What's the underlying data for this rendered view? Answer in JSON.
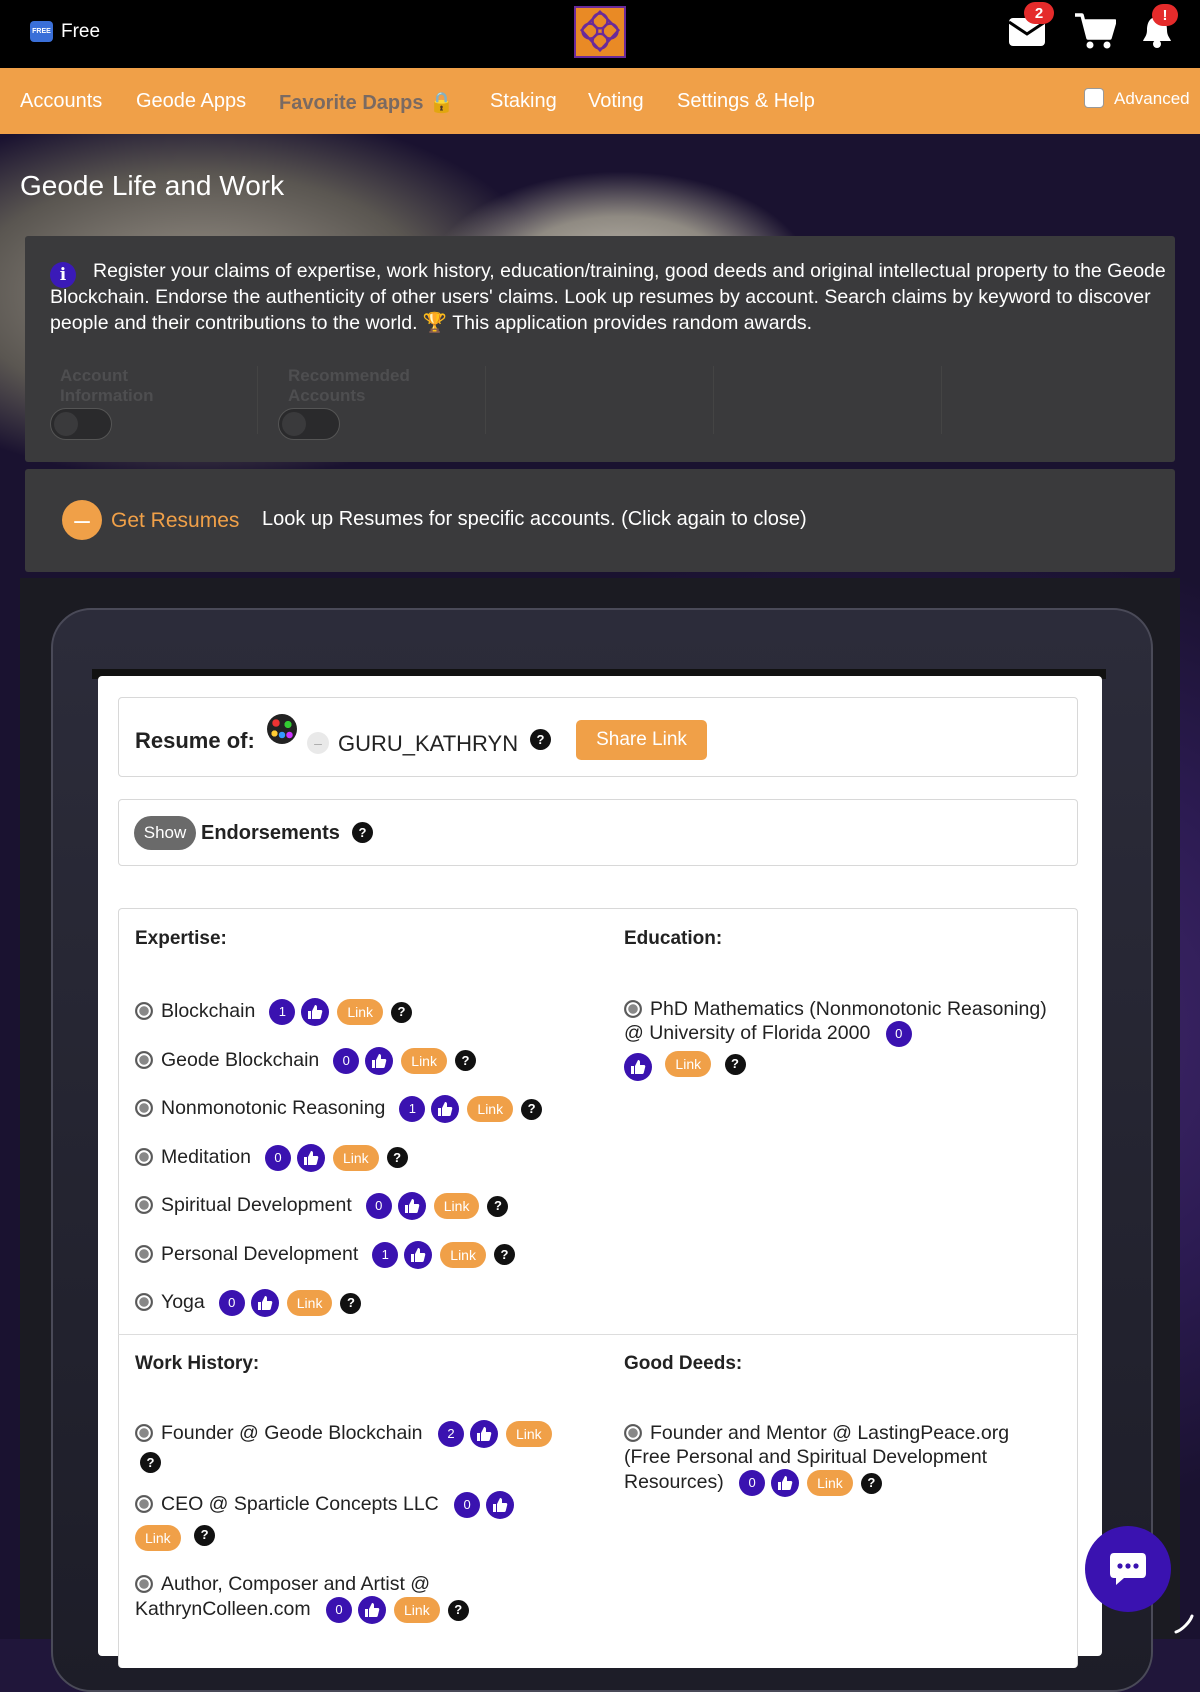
{
  "topbar": {
    "free_badge": "FREE",
    "free_label": "Free",
    "mail_count": "2",
    "bell_badge": "!"
  },
  "nav": {
    "items": [
      "Accounts",
      "Geode Apps",
      "Favorite Dapps 🔒",
      "Staking",
      "Voting",
      "Settings & Help"
    ],
    "advanced_label": "Advanced"
  },
  "page": {
    "title": "Geode Life and Work",
    "info_text": "Register your claims of expertise, work history, education/training, good deeds and original intellectual property to the Geode Blockchain. Endorse the authenticity of other users' claims. Look up resumes by account. Search claims by keyword to discover people and their contributions to the world. 🏆 This application provides random awards.",
    "toggles": [
      "Account Information",
      "Recommended Accounts"
    ]
  },
  "get_resumes": {
    "label": "Get Resumes",
    "description": "Look up Resumes for specific accounts. (Click again to close)"
  },
  "resume": {
    "label": "Resume of:",
    "account": "GURU_KATHRYN",
    "share_label": "Share Link",
    "show_label": "Show",
    "endorsements_label": "Endorsements"
  },
  "sections": {
    "expertise": {
      "title": "Expertise:",
      "items": [
        {
          "name": "Blockchain",
          "count": "1"
        },
        {
          "name": "Geode Blockchain",
          "count": "0"
        },
        {
          "name": "Nonmonotonic Reasoning",
          "count": "1"
        },
        {
          "name": "Meditation",
          "count": "0"
        },
        {
          "name": "Spiritual Development",
          "count": "0"
        },
        {
          "name": "Personal Development",
          "count": "1"
        },
        {
          "name": "Yoga",
          "count": "0"
        }
      ]
    },
    "education": {
      "title": "Education:",
      "items": [
        {
          "name": "PhD Mathematics (Nonmonotonic Reasoning) @ University of Florida 2000",
          "count": "0"
        }
      ]
    },
    "work_history": {
      "title": "Work History:",
      "items": [
        {
          "name": "Founder @ Geode Blockchain",
          "count": "2"
        },
        {
          "name": "CEO @ Sparticle Concepts LLC",
          "count": "0"
        },
        {
          "name": "Author, Composer and Artist @ KathrynColleen.com",
          "count": "0"
        }
      ]
    },
    "good_deeds": {
      "title": "Good Deeds:",
      "items": [
        {
          "name": "Founder and Mentor @ LastingPeace.org (Free Personal and Spiritual Development Resources)",
          "count": "0"
        }
      ]
    }
  },
  "common": {
    "link_label": "Link",
    "help_glyph": "?"
  },
  "colors": {
    "accent_orange": "#f0a048",
    "endorse_purple": "#3a12b0",
    "panel_gray": "#3a3a3c"
  }
}
